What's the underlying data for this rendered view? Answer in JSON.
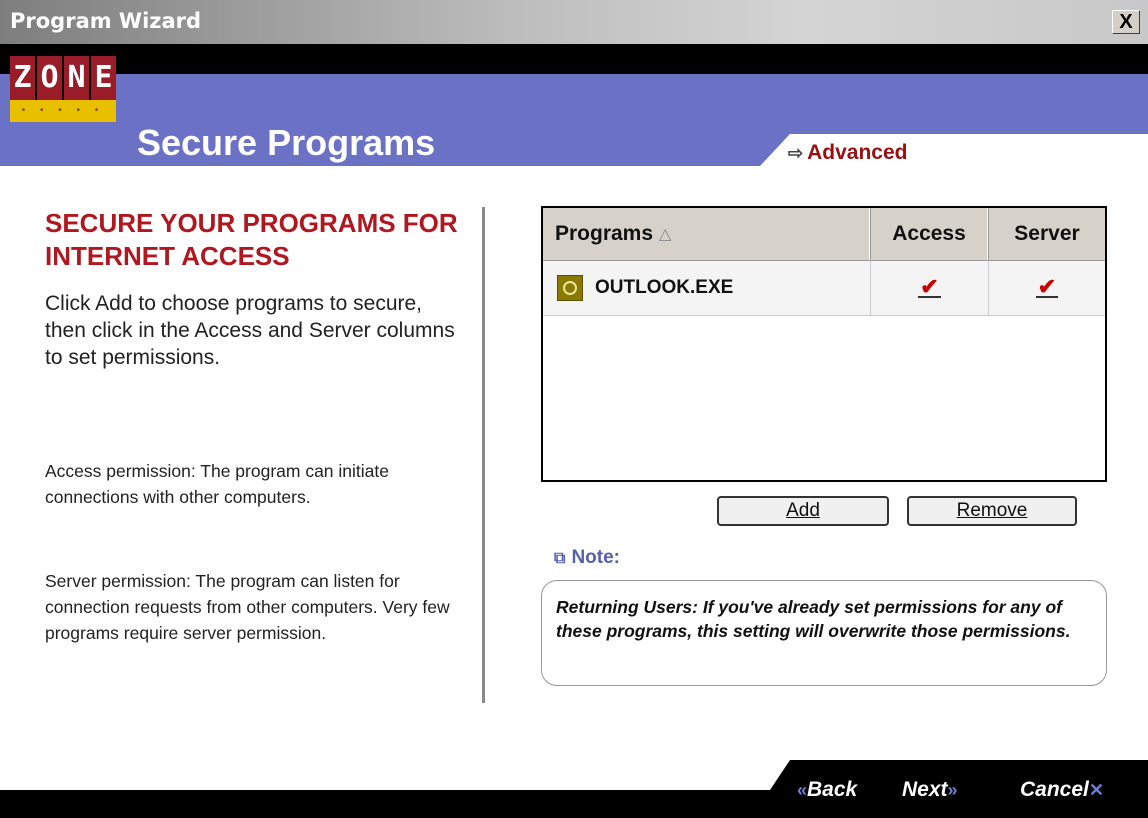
{
  "window": {
    "title": "Program Wizard",
    "close_label": "X"
  },
  "logo": {
    "letters": [
      "Z",
      "O",
      "N",
      "E"
    ],
    "tagline": "• • • • •"
  },
  "header": {
    "title": "Secure Programs",
    "advanced_link": "Advanced",
    "advanced_arrow": "⇨"
  },
  "left": {
    "heading": "SECURE YOUR PROGRAMS FOR INTERNET ACCESS",
    "intro": "Click Add to choose programs to secure, then click in the Access and Server columns to set permissions.",
    "access_text": "Access permission: The program can initiate connections with other computers.",
    "server_text": "Server permission: The program can listen for connection requests from other computers. Very few programs require server permission."
  },
  "table": {
    "columns": [
      "Programs",
      "Access",
      "Server"
    ],
    "sort_indicator": "△",
    "rows": [
      {
        "program": "OUTLOOK.EXE",
        "icon": "outlook-app-icon",
        "access": "✔",
        "server": "✔"
      }
    ]
  },
  "buttons": {
    "add": "Add",
    "remove": "Remove"
  },
  "note": {
    "label": "Note:",
    "icon": "note-icon",
    "text": "Returning Users: If you've already set permissions for any of these programs, this setting will overwrite those permissions."
  },
  "nav": {
    "back": "Back",
    "next": "Next",
    "cancel": "Cancel",
    "back_arrows": "«",
    "next_arrows": "»",
    "cancel_mark": "✕"
  },
  "colors": {
    "header_blue": "#6b72c5",
    "accent_red": "#b0171f",
    "check_red": "#cc0000"
  }
}
